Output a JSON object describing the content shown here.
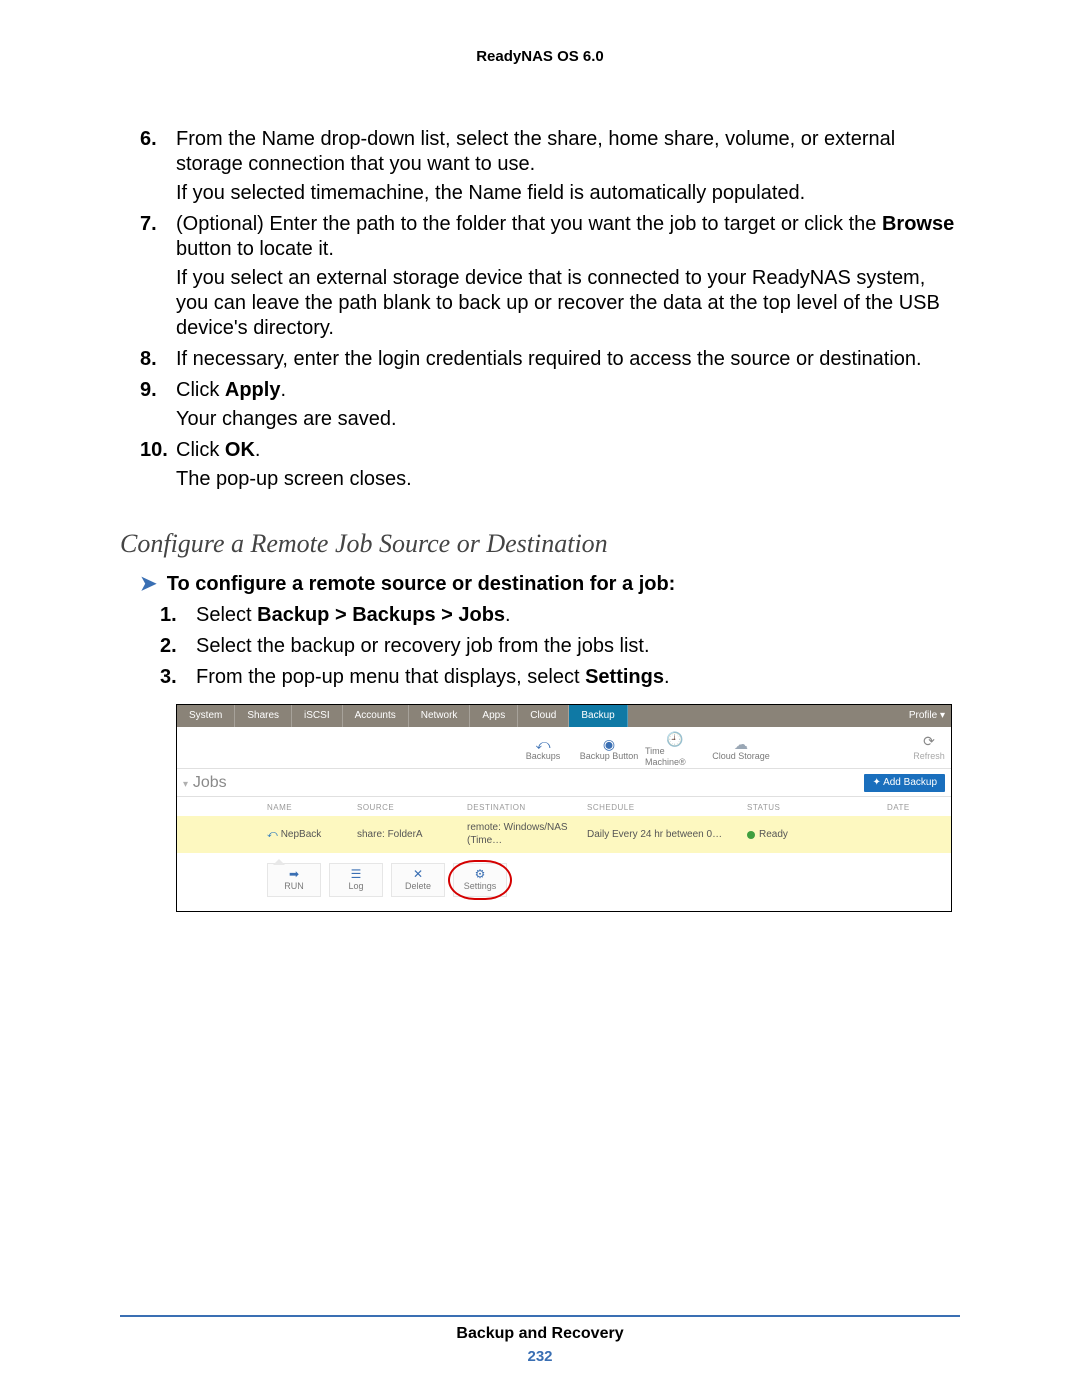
{
  "header": {
    "running": "ReadyNAS OS 6.0"
  },
  "steps": {
    "s6_num": "6.",
    "s6": "From the Name drop-down list, select the share, home share, volume, or external storage connection that you want to use.",
    "s6_sub": "If you selected timemachine, the Name field is automatically populated.",
    "s7_num": "7.",
    "s7_pre": "(Optional) Enter the path to the folder that you want the job to target or click the ",
    "s7_bold": "Browse",
    "s7_post": " button to locate it.",
    "s7_sub": "If you select an external storage device that is connected to your ReadyNAS system, you can leave the path blank to back up or recover the data at the top level of the USB device's directory.",
    "s8_num": "8.",
    "s8": "If necessary, enter the login credentials required to access the source or destination.",
    "s9_num": "9.",
    "s9_pre": "Click ",
    "s9_bold": "Apply",
    "s9_post": ".",
    "s9_sub": "Your changes are saved.",
    "s10_num": "10.",
    "s10_pre": "Click ",
    "s10_bold": "OK",
    "s10_post": ".",
    "s10_sub": "The pop-up screen closes."
  },
  "section": {
    "heading": "Configure a Remote Job Source or Destination"
  },
  "task": {
    "line": "To configure a remote source or destination for a job:"
  },
  "task_steps": {
    "t1_num": "1.",
    "t1_pre": "Select ",
    "t1_bold": "Backup > Backups > Jobs",
    "t1_post": ".",
    "t2_num": "2.",
    "t2": "Select the backup or recovery job from the jobs list.",
    "t3_num": "3.",
    "t3_pre": "From the pop-up menu that displays, select ",
    "t3_bold": "Settings",
    "t3_post": "."
  },
  "figure": {
    "tabs": [
      "System",
      "Shares",
      "iSCSI",
      "Accounts",
      "Network",
      "Apps",
      "Cloud",
      "Backup"
    ],
    "active_tab_index": 7,
    "profile": "Profile ▾",
    "iconrow": {
      "backups": "Backups",
      "backup_button": "Backup Button",
      "time_machine": "Time Machine®",
      "cloud_storage": "Cloud Storage",
      "refresh": "Refresh"
    },
    "jobs_label": "Jobs",
    "add_button": "✦ Add Backup",
    "columns": [
      "NAME",
      "SOURCE",
      "DESTINATION",
      "SCHEDULE",
      "STATUS",
      "DATE"
    ],
    "row": {
      "name": "NepBack",
      "source": "share: FolderA",
      "destination": "remote: Windows/NAS (Time…",
      "schedule": "Daily Every 24 hr between 0…",
      "status": "Ready",
      "date": ""
    },
    "actions": {
      "run": "RUN",
      "log": "Log",
      "delete": "Delete",
      "settings": "Settings"
    }
  },
  "footer": {
    "title": "Backup and Recovery",
    "page": "232"
  }
}
